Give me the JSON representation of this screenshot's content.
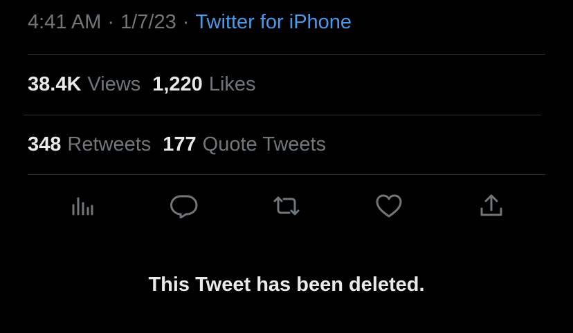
{
  "meta": {
    "time": "4:41 AM",
    "separator": "·",
    "date": "1/7/23",
    "source": "Twitter for iPhone"
  },
  "stats_primary": [
    {
      "value": "38.4K",
      "label": "Views"
    },
    {
      "value": "1,220",
      "label": "Likes"
    }
  ],
  "stats_secondary": [
    {
      "value": "348",
      "label": "Retweets"
    },
    {
      "value": "177",
      "label": "Quote Tweets"
    }
  ],
  "actions": [
    {
      "icon": "analytics-icon"
    },
    {
      "icon": "reply-icon"
    },
    {
      "icon": "retweet-icon"
    },
    {
      "icon": "like-icon"
    },
    {
      "icon": "share-icon"
    }
  ],
  "deleted_message": "This Tweet has been deleted.",
  "colors": {
    "background": "#000000",
    "primary_text": "#e7e9ea",
    "secondary_text": "#71767b",
    "link": "#4a99e9",
    "divider": "#2f3336"
  }
}
